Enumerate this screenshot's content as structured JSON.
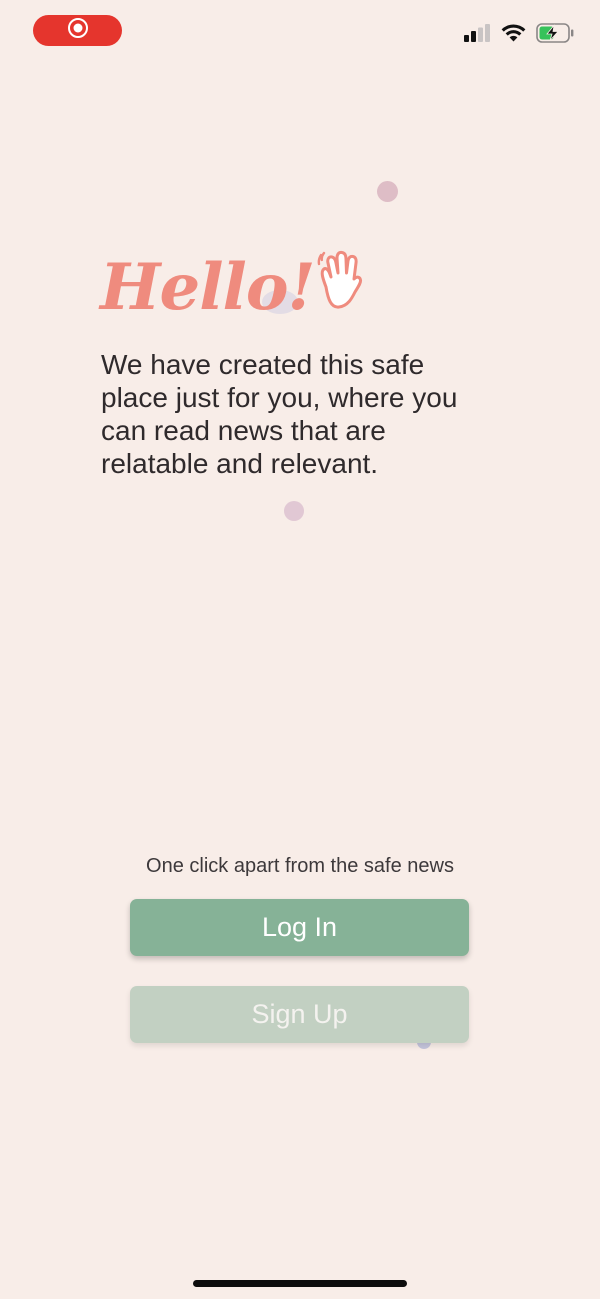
{
  "status_bar": {
    "recording_icon": "screen-recording-icon",
    "signal_icon": "cellular-signal-icon",
    "wifi_icon": "wifi-icon",
    "battery_icon": "battery-charging-icon"
  },
  "welcome": {
    "headline": "Hello!",
    "headline_icon": "waving-hand-icon",
    "message": "We have created this safe place just for you, where you can read news that are relatable and relevant."
  },
  "auth": {
    "tagline": "One click apart from the safe news",
    "login_label": "Log In",
    "signup_label": "Sign Up"
  },
  "colors": {
    "background": "#f8ede8",
    "headline": "#ef8b7e",
    "login_button": "#86b297",
    "signup_button": "#c2d0c2",
    "recording_pill": "#e5352d"
  }
}
